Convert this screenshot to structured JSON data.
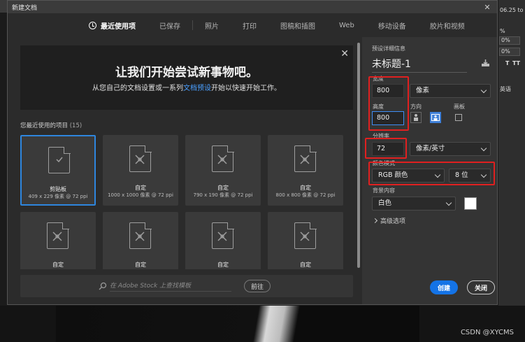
{
  "dialog": {
    "title": "新建文档",
    "close_glyph": "✕"
  },
  "tabs": [
    {
      "label": "最近使用项",
      "active": true
    },
    {
      "label": "已保存"
    },
    {
      "label": "照片"
    },
    {
      "label": "打印"
    },
    {
      "label": "图稿和插图"
    },
    {
      "label": "Web"
    },
    {
      "label": "移动设备"
    },
    {
      "label": "胶片和视频"
    }
  ],
  "banner": {
    "title": "让我们开始尝试新事物吧。",
    "subtitle_pre": "从您自己的文档设置或一系列",
    "subtitle_link": "文档预设",
    "subtitle_post": "开始以快速开始工作。",
    "close_glyph": "✕"
  },
  "recent": {
    "label": "您最近使用的项目",
    "count": "(15)"
  },
  "presets": [
    {
      "name": "剪贴板",
      "size": "409 x 229 像素 @ 72 ppi",
      "icon": "clipboard-check-icon",
      "selected": true
    },
    {
      "name": "自定",
      "size": "1000 x 1000 像素 @ 72 ppi",
      "icon": "custom-doc-icon"
    },
    {
      "name": "自定",
      "size": "790 x 190 像素 @ 72 ppi",
      "icon": "custom-doc-icon"
    },
    {
      "name": "自定",
      "size": "800 x 800 像素 @ 72 ppi",
      "icon": "custom-doc-icon"
    },
    {
      "name": "自定",
      "size": "",
      "icon": "custom-doc-icon"
    },
    {
      "name": "自定",
      "size": "",
      "icon": "custom-doc-icon"
    },
    {
      "name": "自定",
      "size": "",
      "icon": "custom-doc-icon"
    },
    {
      "name": "自定",
      "size": "",
      "icon": "custom-doc-icon"
    }
  ],
  "search": {
    "placeholder": "在 Adobe Stock 上查找模板",
    "goto_label": "前往"
  },
  "details": {
    "section_title": "预设详细信息",
    "doc_name": "未标题-1",
    "width_label": "宽度",
    "width_value": "800",
    "width_unit": "像素",
    "height_label": "高度",
    "height_value": "800",
    "orientation_label": "方向",
    "artboard_label": "画板",
    "resolution_label": "分辨率",
    "resolution_value": "72",
    "resolution_unit": "像素/英寸",
    "color_mode_label": "颜色模式",
    "color_mode_value": "RGB 颜色",
    "bit_depth_value": "8 位",
    "bg_label": "背景内容",
    "bg_value": "白色",
    "advanced_label": "高级选项",
    "create_label": "创建",
    "close_label": "关闭"
  },
  "background_app": {
    "zoom_text": "06.25 to",
    "percent_1": "%",
    "percent_2": "0%",
    "percent_3": "0%",
    "tt_1": "T",
    "tt_2": "TT",
    "lang": "英语"
  },
  "watermark": "CSDN @XYCMS",
  "colors": {
    "accent": "#1473e6",
    "highlight_box": "#e02020",
    "link": "#4a9fff"
  }
}
